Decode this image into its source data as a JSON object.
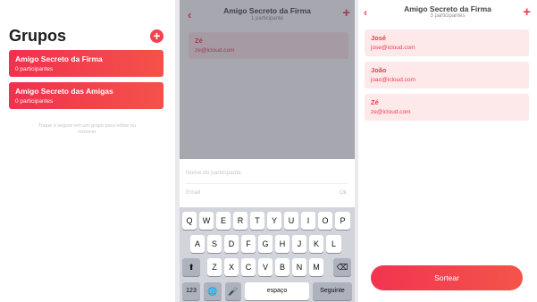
{
  "screen_groups": {
    "title": "Grupos",
    "groups": [
      {
        "name": "Amigo Secreto da Firma",
        "count": "0 participantes"
      },
      {
        "name": "Amigo Secreto das Amigas",
        "count": "0 participantes"
      }
    ],
    "hint": "Toque e segure em um grupo para editar ou remover"
  },
  "screen_add": {
    "title": "Amigo Secreto da Firma",
    "subtitle": "1 participante",
    "participants": [
      {
        "name": "Zé",
        "email": "ze@icloud.com"
      }
    ],
    "form": {
      "name_placeholder": "Nome do participante",
      "email_placeholder": "Email",
      "ok_label": "Ok"
    },
    "keyboard": {
      "row1": [
        "Q",
        "W",
        "E",
        "R",
        "T",
        "Y",
        "U",
        "I",
        "O",
        "P"
      ],
      "row2": [
        "A",
        "S",
        "D",
        "F",
        "G",
        "H",
        "J",
        "K",
        "L"
      ],
      "row3": [
        "Z",
        "X",
        "C",
        "V",
        "B",
        "N",
        "M"
      ],
      "numbers_key": "123",
      "space_key": "espaço",
      "return_key": "Seguinte"
    }
  },
  "screen_list": {
    "title": "Amigo Secreto da Firma",
    "subtitle": "3 participantes",
    "participants": [
      {
        "name": "José",
        "email": "jose@icloud.com"
      },
      {
        "name": "João",
        "email": "joao@icloud.com"
      },
      {
        "name": "Zé",
        "email": "ze@icloud.com"
      }
    ],
    "draw_label": "Sortear"
  },
  "colors": {
    "accent": "#ef3c4f",
    "card_light": "#fde9ea",
    "keyboard_bg": "#d2d4db"
  }
}
